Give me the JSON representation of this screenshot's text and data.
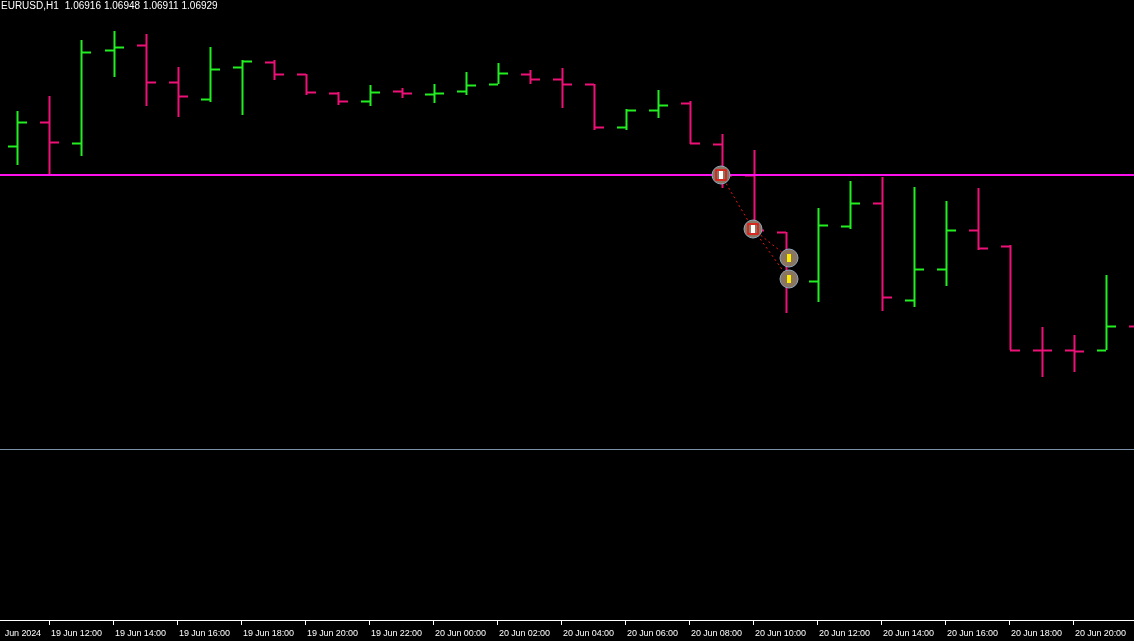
{
  "chart_header": {
    "symbol": "EURUSD,H1",
    "prices": [
      "1.06916",
      "1.06948",
      "1.06911",
      "1.06929"
    ]
  },
  "time_axis": {
    "labels": [
      "Jun 2024",
      "19 Jun 12:00",
      "19 Jun 14:00",
      "19 Jun 16:00",
      "19 Jun 18:00",
      "19 Jun 20:00",
      "19 Jun 22:00",
      "20 Jun 00:00",
      "20 Jun 02:00",
      "20 Jun 04:00",
      "20 Jun 06:00",
      "20 Jun 08:00",
      "20 Jun 10:00",
      "20 Jun 12:00",
      "20 Jun 14:00",
      "20 Jun 16:00",
      "20 Jun 18:00",
      "20 Jun 20:00"
    ]
  }
}
